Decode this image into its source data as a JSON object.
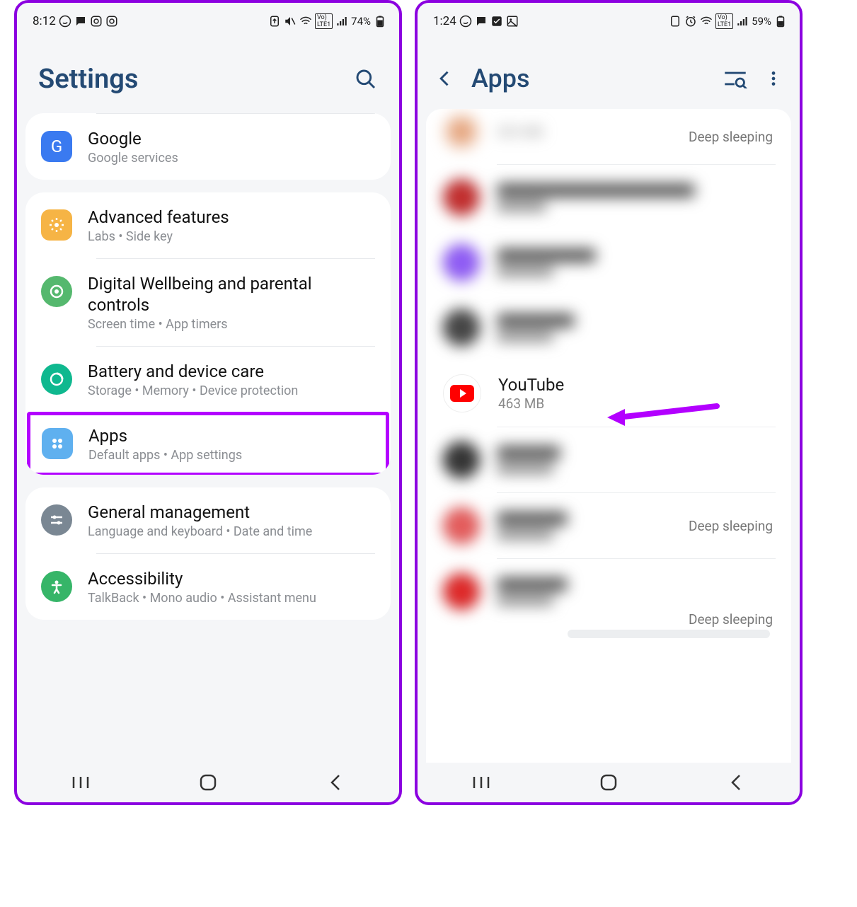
{
  "left": {
    "status": {
      "time": "8:12",
      "battery": "74%"
    },
    "header": {
      "title": "Settings"
    },
    "first_card": {
      "google": {
        "title": "Google",
        "sub": "Google services"
      }
    },
    "second_card": {
      "advanced": {
        "title": "Advanced features",
        "sub": "Labs  •  Side key"
      },
      "wellbeing": {
        "title": "Digital Wellbeing and parental controls",
        "sub": "Screen time  •  App timers"
      },
      "battery": {
        "title": "Battery and device care",
        "sub": "Storage  •  Memory  •  Device protection"
      },
      "apps_row": {
        "title": "Apps",
        "sub": "Default apps  •  App settings"
      }
    },
    "third_card": {
      "general": {
        "title": "General management",
        "sub": "Language and keyboard  •  Date and time"
      },
      "accessibility": {
        "title": "Accessibility",
        "sub": "TalkBack  •  Mono audio  •  Assistant menu"
      }
    }
  },
  "right": {
    "status": {
      "time": "1:24",
      "battery": "59%"
    },
    "header": {
      "title": "Apps"
    },
    "partial_top": {
      "size": "303 MB",
      "status": "Deep sleeping"
    },
    "youtube": {
      "name": "YouTube",
      "size": "463 MB"
    },
    "status_labels": {
      "deep1": "Deep sleeping",
      "deep2": "Deep sleeping"
    }
  }
}
